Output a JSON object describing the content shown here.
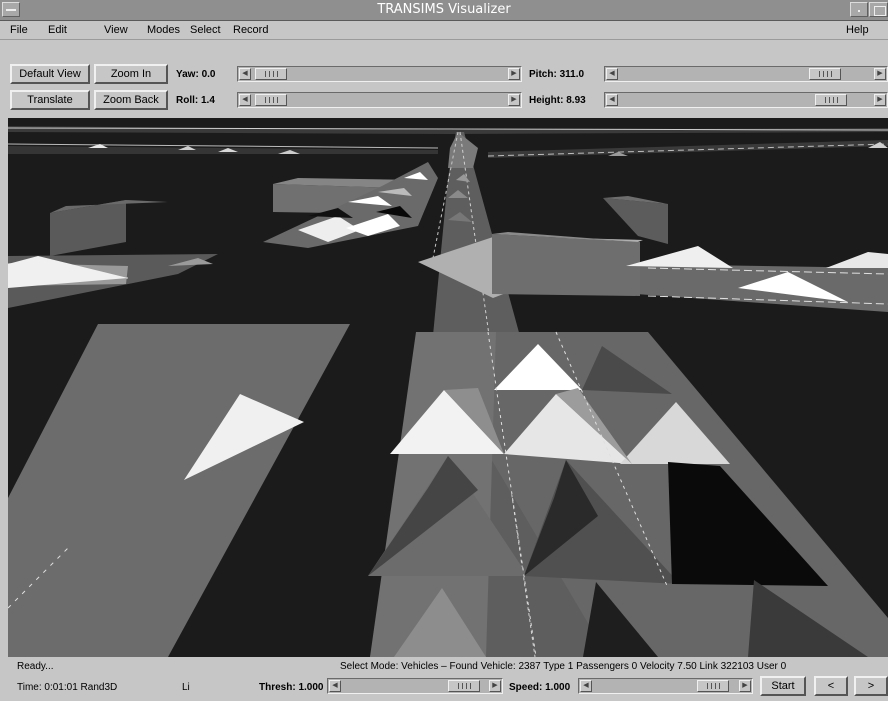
{
  "window": {
    "title": "TRANSIMS Visualizer"
  },
  "menubar": {
    "file": "File",
    "edit": "Edit",
    "view": "View",
    "modes": "Modes",
    "select": "Select",
    "record": "Record",
    "help": "Help"
  },
  "toolbar": {
    "default_view": "Default View",
    "zoom_in": "Zoom In",
    "translate": "Translate",
    "zoom_back": "Zoom Back",
    "yaw_label": "Yaw:",
    "yaw_value": "0.0",
    "roll_label": "Roll:",
    "roll_value": "1.4",
    "pitch_label": "Pitch:",
    "pitch_value": "311.0",
    "height_label": "Height:",
    "height_value": "8.93"
  },
  "status": {
    "ready": "Ready...",
    "message": "Select Mode: Vehicles – Found Vehicle: 2387 Type 1 Passengers 0 Velocity 7.50 Link 322103 User 0",
    "time": "Time: 0:01:01 Rand3D",
    "li": "Li",
    "thresh_label": "Thresh:",
    "thresh_value": "1.000",
    "speed_label": "Speed:",
    "speed_value": "1.000",
    "start": "Start",
    "prev": "<",
    "next": ">"
  },
  "colors": {
    "scene_bg": "#1b1b1b",
    "road": "#5e5e5e",
    "vehicle_light": "#e8e8e8"
  }
}
